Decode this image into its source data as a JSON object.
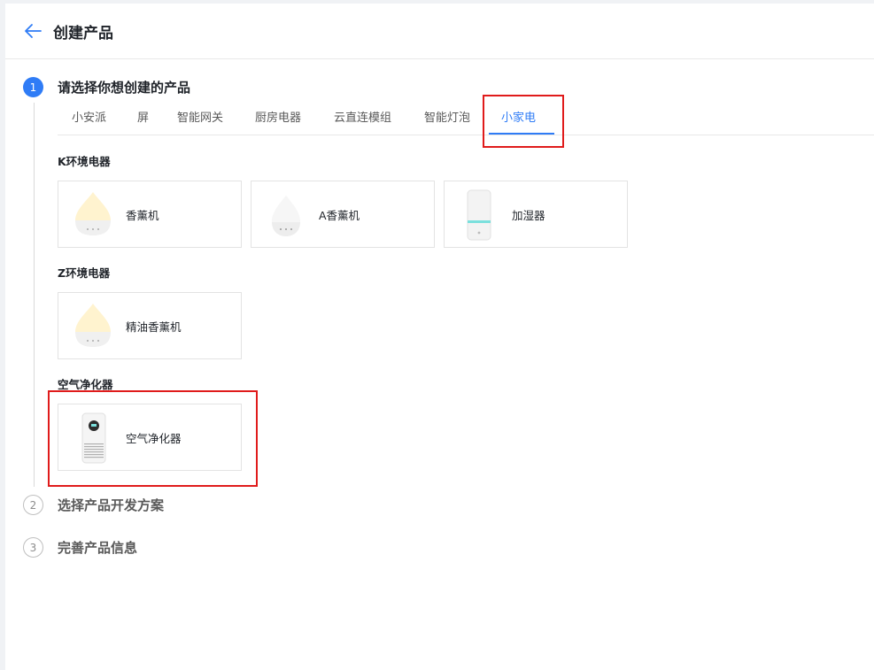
{
  "header": {
    "title": "创建产品",
    "back_icon": "arrow-left-icon"
  },
  "steps": [
    {
      "number": "1",
      "label": "请选择你想创建的产品",
      "state": "active"
    },
    {
      "number": "2",
      "label": "选择产品开发方案",
      "state": "pending"
    },
    {
      "number": "3",
      "label": "完善产品信息",
      "state": "pending"
    }
  ],
  "tabs": [
    {
      "label": "小安派"
    },
    {
      "label": "屏"
    },
    {
      "label": "智能网关"
    },
    {
      "label": "厨房电器"
    },
    {
      "label": "云直连模组"
    },
    {
      "label": "智能灯泡"
    },
    {
      "label": "小家电",
      "active": true
    }
  ],
  "sections": [
    {
      "title": "K环境电器",
      "cards": [
        {
          "name": "香薰机",
          "icon": "aroma-diffuser-icon"
        },
        {
          "name": "A香薰机",
          "icon": "aroma-diffuser-icon"
        },
        {
          "name": "加湿器",
          "icon": "humidifier-icon"
        }
      ]
    },
    {
      "title": "Z环境电器",
      "cards": [
        {
          "name": "精油香薰机",
          "icon": "aroma-diffuser-icon"
        }
      ]
    },
    {
      "title": "空气净化器",
      "cards": [
        {
          "name": "空气净化器",
          "icon": "air-purifier-icon"
        }
      ]
    }
  ],
  "colors": {
    "accent": "#2f7cf6",
    "highlight": "#e01b1b"
  }
}
